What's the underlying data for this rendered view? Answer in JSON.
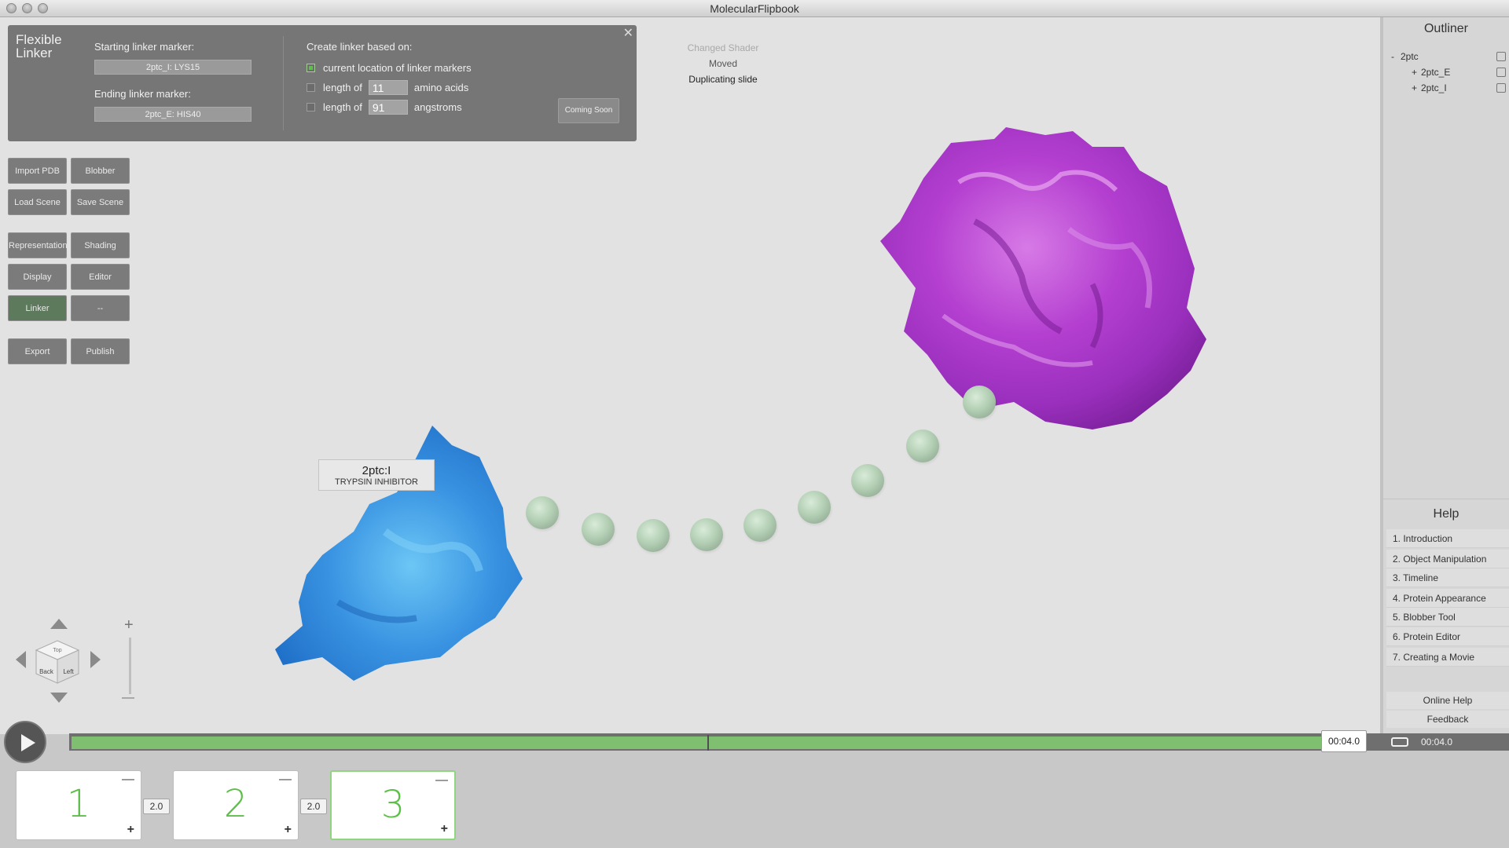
{
  "app": {
    "title": "MolecularFlipbook"
  },
  "linker_panel": {
    "title": "Flexible Linker",
    "start_label": "Starting linker marker:",
    "start_value": "2ptc_I: LYS15",
    "end_label": "Ending linker marker:",
    "end_value": "2ptc_E: HIS40",
    "create_label": "Create linker based on:",
    "opt_current": "current location of linker markers",
    "opt_length_of": "length of",
    "aa_value": "11",
    "aa_unit": "amino acids",
    "angstrom_value": "91",
    "angstrom_unit": "angstroms",
    "coming_soon": "Coming Soon"
  },
  "status_log": [
    "Changed Shader",
    "Moved",
    "Duplicating slide"
  ],
  "toolbar": {
    "import_pdb": "Import PDB",
    "blobber": "Blobber",
    "load_scene": "Load Scene",
    "save_scene": "Save Scene",
    "representation": "Representation",
    "shading": "Shading",
    "display": "Display",
    "editor": "Editor",
    "linker": "Linker",
    "dash": "--",
    "export": "Export",
    "publish": "Publish"
  },
  "molecule_label": {
    "name": "2ptc:I",
    "desc": "TRYPSIN INHIBITOR"
  },
  "nav_cube": {
    "back": "Back",
    "left": "Left",
    "top": "Top"
  },
  "zoom": {
    "plus": "+",
    "minus": "—"
  },
  "outliner": {
    "title": "Outliner",
    "root": "2ptc",
    "root_toggle": "-",
    "children": [
      {
        "toggle": "+",
        "label": "2ptc_E"
      },
      {
        "toggle": "+",
        "label": "2ptc_I"
      }
    ]
  },
  "help": {
    "title": "Help",
    "items": [
      "1. Introduction",
      "2. Object Manipulation",
      "3. Timeline",
      "4. Protein Appearance",
      "5. Blobber Tool",
      "6. Protein Editor",
      "7. Creating a Movie"
    ],
    "online_help": "Online Help",
    "feedback": "Feedback"
  },
  "timeline": {
    "current_time": "00:04.0",
    "total_time": "00:04.0",
    "slides": [
      {
        "number": "1",
        "selected": false
      },
      {
        "number": "2",
        "selected": false
      },
      {
        "number": "3",
        "selected": true
      }
    ],
    "durations": [
      "2.0",
      "2.0"
    ],
    "slide_minus": "—",
    "slide_plus": "+"
  },
  "colors": {
    "accent_green": "#7ec06f",
    "protein_magenta": "#b53fd3",
    "protein_blue": "#3a8fe0",
    "linker_sphere": "#b3cfb4"
  }
}
